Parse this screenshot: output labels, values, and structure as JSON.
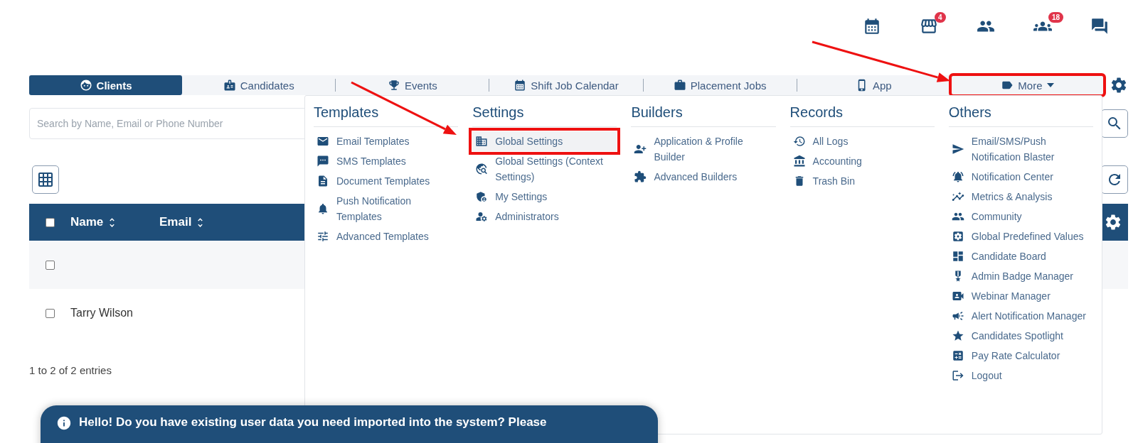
{
  "header": {
    "icons": [
      {
        "kind": "calendar"
      },
      {
        "kind": "store",
        "badge": "4"
      },
      {
        "kind": "people"
      },
      {
        "kind": "group",
        "badge": "18"
      },
      {
        "kind": "chat"
      }
    ]
  },
  "tabs": [
    {
      "label": "Clients",
      "selected": true,
      "outlined": false
    },
    {
      "label": "Candidates",
      "selected": false,
      "outlined": false
    },
    {
      "label": "Events",
      "selected": false,
      "outlined": false
    },
    {
      "label": "Shift Job Calendar",
      "selected": false,
      "outlined": false
    },
    {
      "label": "Placement Jobs",
      "selected": false,
      "outlined": false
    },
    {
      "label": "App",
      "selected": false,
      "outlined": false
    },
    {
      "label": "More",
      "selected": false,
      "outlined": true
    }
  ],
  "search": {
    "placeholder": "Search by Name, Email or Phone Number"
  },
  "table": {
    "header_checked": false,
    "columns": [
      "Name",
      "Email"
    ],
    "rows": [
      {
        "checked": false
      },
      {
        "checked": false,
        "name": "Tarry Wilson"
      }
    ]
  },
  "entries": "1 to 2 of 2 entries",
  "banner": "Hello! Do you have existing user data you need imported into the system? Please",
  "menu": [
    {
      "title": "Templates",
      "items": [
        {
          "label": "Email Templates",
          "highlighted": false
        },
        {
          "label": "SMS Templates",
          "highlighted": false
        },
        {
          "label": "Document Templates",
          "highlighted": false
        },
        {
          "label": "Push Notification Templates",
          "highlighted": false
        },
        {
          "label": "Advanced Templates",
          "highlighted": false
        }
      ]
    },
    {
      "title": "Settings",
      "items": [
        {
          "label": "Global Settings",
          "highlighted": true
        },
        {
          "label": "Global Settings (Context Settings)",
          "highlighted": false
        },
        {
          "label": "My Settings",
          "highlighted": false
        },
        {
          "label": "Administrators",
          "highlighted": false
        }
      ]
    },
    {
      "title": "Builders",
      "items": [
        {
          "label": "Application & Profile Builder",
          "highlighted": false
        },
        {
          "label": "Advanced Builders",
          "highlighted": false
        }
      ]
    },
    {
      "title": "Records",
      "items": [
        {
          "label": "All Logs",
          "highlighted": false
        },
        {
          "label": "Accounting",
          "highlighted": false
        },
        {
          "label": "Trash Bin",
          "highlighted": false
        }
      ]
    },
    {
      "title": "Others",
      "items": [
        {
          "label": "Email/SMS/Push Notification Blaster",
          "highlighted": false
        },
        {
          "label": "Notification Center",
          "highlighted": false
        },
        {
          "label": "Metrics & Analysis",
          "highlighted": false
        },
        {
          "label": "Community",
          "highlighted": false
        },
        {
          "label": "Global Predefined Values",
          "highlighted": false
        },
        {
          "label": "Candidate Board",
          "highlighted": false
        },
        {
          "label": "Admin Badge Manager",
          "highlighted": false
        },
        {
          "label": "Webinar Manager",
          "highlighted": false
        },
        {
          "label": "Alert Notification Manager",
          "highlighted": false
        },
        {
          "label": "Candidates Spotlight",
          "highlighted": false
        },
        {
          "label": "Pay Rate Calculator",
          "highlighted": false
        },
        {
          "label": "Logout",
          "highlighted": false
        }
      ]
    }
  ]
}
